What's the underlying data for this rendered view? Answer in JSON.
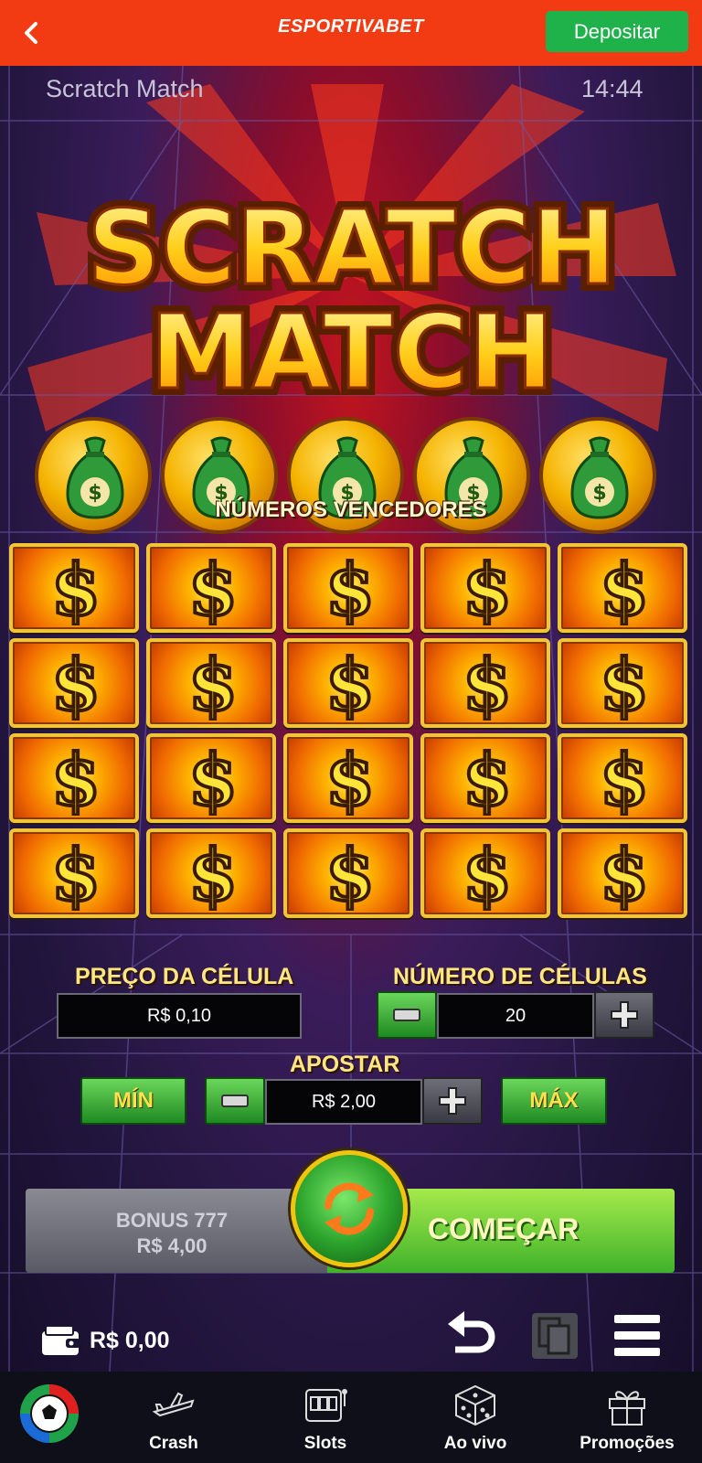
{
  "topbar": {
    "back_icon": "chevron-left-icon",
    "brand": "ESPORTIVABET",
    "deposit_label": "Depositar"
  },
  "game": {
    "title": "Scratch Match",
    "clock": "14:44",
    "logo_line1": "SCRATCH",
    "logo_line2": "MATCH",
    "winning_label": "NÚMEROS VENCEDORES",
    "coin_icon": "money-bag-icon",
    "cell_icon": "dollar-sign-icon",
    "cell_count_rows": 4,
    "cell_count_cols": 5
  },
  "controls": {
    "cell_price_label": "PREÇO DA CÉLULA",
    "cell_price_value": "R$ 0,10",
    "cell_count_label": "NÚMERO DE CÉLULAS",
    "cell_count_value": "20",
    "bet_label": "APOSTAR",
    "min_label": "MÍN",
    "max_label": "MÁX",
    "bet_value": "R$ 2,00",
    "bonus_name": "BONUS 777",
    "bonus_value": "R$ 4,00",
    "start_label": "COMEÇAR",
    "balance": "R$ 0,00"
  },
  "nav": {
    "items": [
      {
        "label": "Crash",
        "icon": "airplane-icon"
      },
      {
        "label": "Slots",
        "icon": "slot-machine-icon"
      },
      {
        "label": "Ao vivo",
        "icon": "dice-icon"
      },
      {
        "label": "Promoções",
        "icon": "gift-icon"
      }
    ]
  },
  "colors": {
    "topbar": "#f23b12",
    "deposit": "#1fb24a",
    "accent_yellow": "#ffe680",
    "button_green": "#1f8a22"
  }
}
